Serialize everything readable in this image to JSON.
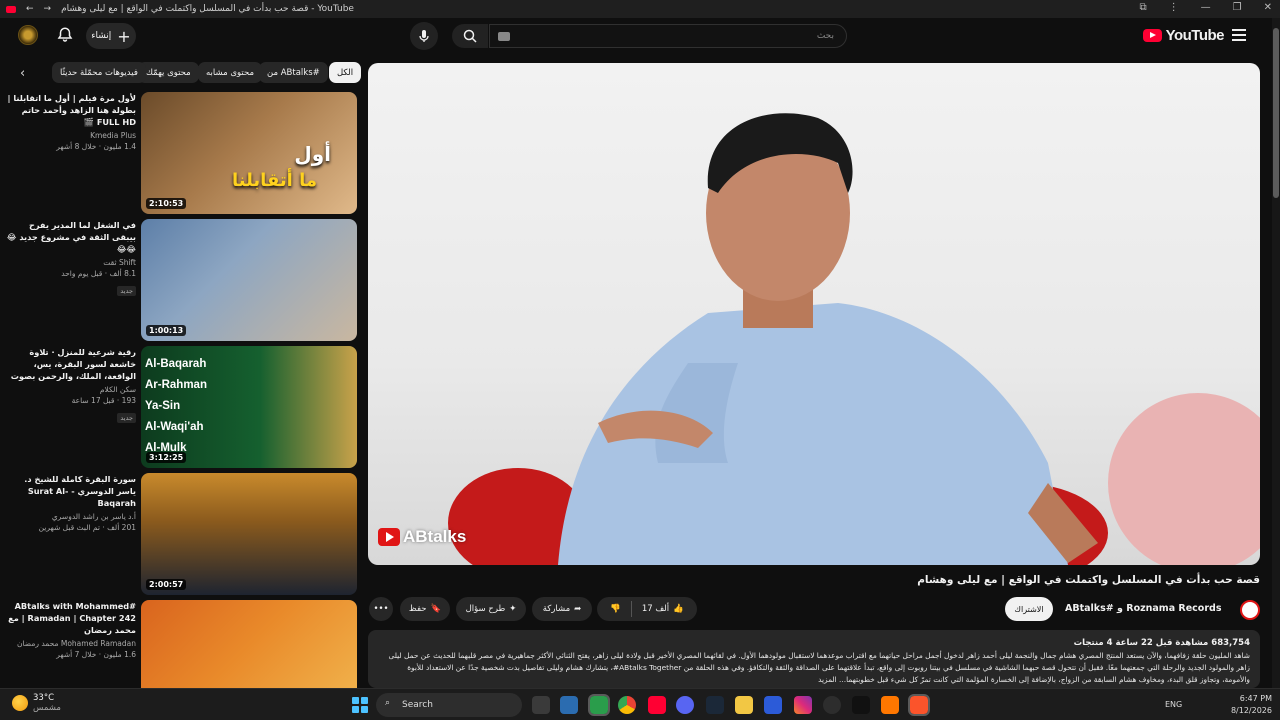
{
  "browser": {
    "tab_title": "قصة حب بدأت في المسلسل واكتملت في الواقع | مع ليلى وهشام - YouTube"
  },
  "header": {
    "logo_text": "YouTube",
    "search_placeholder": "بحث",
    "create_label": "إنشاء"
  },
  "chips": [
    "الكل",
    "من ABtalks#",
    "محتوى مشابه",
    "محتوى يهمّك",
    "فيديوهات محمّلة حديثًا"
  ],
  "sidebar": {
    "videos": [
      {
        "title": "لأول مرة فيلم | أول ما اتقابلنا | بطولة هنا الزاهد وأحمد حاتم FULL HD 🎬",
        "channel": "Kmedia Plus",
        "views": "1.4 مليون · خلال 8 أشهر",
        "duration": "2:10:53",
        "badge": ""
      },
      {
        "title": "في الشغل لما المدير يفرح بيبقى الثقة في مشروع جديد 😂😂😂",
        "channel": "Shift ثقت",
        "views": "8.1 ألف · قبل يوم واحد",
        "duration": "1:00:13",
        "badge": "جديد"
      },
      {
        "title": "رقية شرعية للمنزل · تلاوة خاشعة لسور البقرة، يس، الواقعة، الملك، والرحمن بصوت الشيخ ماهر المعيقلي 📍",
        "channel": "سكن الكلام",
        "views": "193 · قبل 17 ساعة",
        "duration": "3:12:25",
        "badge": "جديد"
      },
      {
        "title": "سورة البقرة كاملة للشيخ د. ياسر الدوسري - Surat Al-Baqarah",
        "channel": "أ.د ياسر بن راشد الدوسري",
        "views": "201 ألف · تم البث قبل شهرين",
        "duration": "2:00:57",
        "badge": ""
      },
      {
        "title": "ABtalks with Mohammed# Ramadan | Chapter 242 | مع محمد رمضان",
        "channel": "Mohamed Ramadan محمد رمضان",
        "views": "1.6 مليون · خلال 7 أشهر",
        "duration": "",
        "badge": ""
      }
    ]
  },
  "video": {
    "title": "قصة حب بدأت في المسلسل واكتملت في الواقع | مع ليلى وهشام",
    "channel": "ABtalks# و Roznama Records",
    "subscribe": "الاشتراك",
    "likes": "17 ألف",
    "share": "مشاركة",
    "ask": "طرح سؤال",
    "save": "حفظ",
    "watermark": "ABtalks",
    "stats": "683,754 مشاهدة قبل 22 ساعة 4 منتجات",
    "description": "شاهد المليون حلقة زفافهما، والآن يستعد المنتج المصري هشام جمال والنجمة ليلى أحمد زاهر لدخول أجمل مراحل حياتهما مع اقتراب موعدهما لاستقبال مولودهما الأول. في لقائهما المصري الأخير قبل ولادة ليلى زاهر، يفتح الثنائي الأكثر جماهيرية في مصر قلبهما للحديث عن حمل ليلى زاهر والمولود الجديد والرحلة التي جمعتهما معًا. فقبل أن تتحول قصة حبهما الشاشية في مسلسل في بيتنا روبوت إلى واقع، تبدأ علاقتهما على الصداقة والثقة والتكافؤ. وفي هذه الحلقة من ABtalks Together#، يتشارك هشام وليلى تفاصيل بدت شخصية جدًا عن الاستعداد للأبوة والأمومة، وتجاوز قلق البدء، ومخاوف هشام السابقة من الزواج، بالإضافة إلى الخسارة المؤلمة التي كانت تمرّ كل شيء قبل خطوبتهما... المزيد"
  },
  "taskbar": {
    "temp": "33°C",
    "weather_text": "مشمس",
    "search_label": "Search",
    "lang": "ENG",
    "time": "6:47 PM",
    "date": "8/12/2026"
  },
  "colors": {
    "brand": "#ff0033",
    "bg": "#0f0f0f",
    "chip": "#272727"
  }
}
